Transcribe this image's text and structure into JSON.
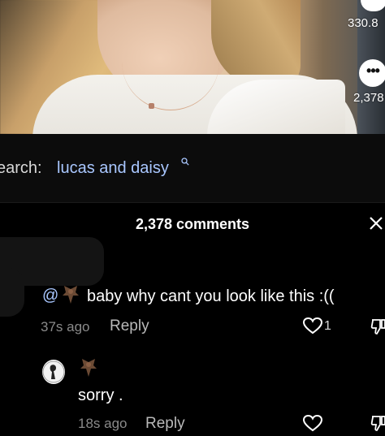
{
  "video": {
    "like_count": "330.8",
    "comment_count": "2,378"
  },
  "search": {
    "prefix": "earch:",
    "term": "lucas and daisy"
  },
  "comments_panel": {
    "title": "2,378 comments"
  },
  "comments": [
    {
      "mention": "@",
      "text": "baby why cant you look like this :((",
      "time": "37s ago",
      "reply_label": "Reply",
      "likes": "1"
    },
    {
      "text": "sorry .",
      "time": "18s ago",
      "reply_label": "Reply"
    }
  ],
  "colors": {
    "background": "#000000",
    "search_term": "#a9c7ff",
    "mention": "#a9c7ff"
  }
}
